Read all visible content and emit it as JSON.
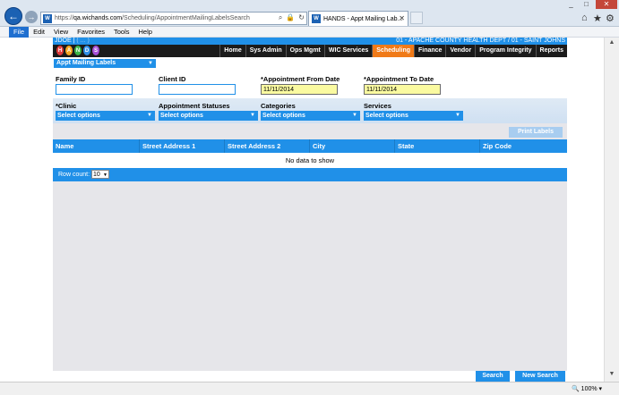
{
  "browser": {
    "url_prefix": "https://",
    "url_host": "qa.wichands.com",
    "url_path": "/Scheduling/AppointmentMailingLabelsSearch",
    "tab_title": "HANDS - Appt Mailing Lab...",
    "favicon_text": "W",
    "zoom": "100%",
    "back_icon": "back-arrow-icon",
    "forward_icon": "forward-arrow-icon",
    "window_controls": [
      "_",
      "□",
      "✕"
    ]
  },
  "menubar": [
    "File",
    "Edit",
    "View",
    "Favorites",
    "Tools",
    "Help"
  ],
  "app": {
    "user": "JDOE |",
    "user_extra": "( ... )",
    "dept": "01 - APACHE COUNTY HEALTH DEPT / 01 - SAINT JOHNS",
    "logo_letters": [
      "H",
      "A",
      "N",
      "D",
      "S"
    ],
    "logo_colors": [
      "#e23b3b",
      "#f5a623",
      "#3bb54a",
      "#2e8ee8",
      "#a64fd6"
    ],
    "nav": [
      "Home",
      "Sys Admin",
      "Ops Mgmt",
      "WIC Services",
      "Scheduling",
      "Finance",
      "Vendor",
      "Program Integrity",
      "Reports"
    ],
    "page_dropdown": "Appt Mailing Labels",
    "fields": {
      "family_id": {
        "label": "Family ID",
        "value": ""
      },
      "client_id": {
        "label": "Client ID",
        "value": ""
      },
      "from_date": {
        "label": "*Appointment From Date",
        "value": "11/11/2014"
      },
      "to_date": {
        "label": "*Appointment To Date",
        "value": "11/11/2014"
      }
    },
    "multiselects": {
      "clinic": {
        "label": "*Clinic",
        "value": "Select options"
      },
      "statuses": {
        "label": "Appointment Statuses",
        "value": "Select options"
      },
      "categories": {
        "label": "Categories",
        "value": "Select options"
      },
      "services": {
        "label": "Services",
        "value": "Select options"
      }
    },
    "print_labels": "Print Labels",
    "grid": {
      "columns": [
        "Name",
        "Street Address 1",
        "Street Address 2",
        "City",
        "State",
        "Zip Code"
      ],
      "empty_text": "No data to show",
      "row_count_label": "Row count:",
      "row_count_value": "10"
    },
    "buttons": {
      "search": "Search",
      "new_search": "New Search"
    }
  }
}
